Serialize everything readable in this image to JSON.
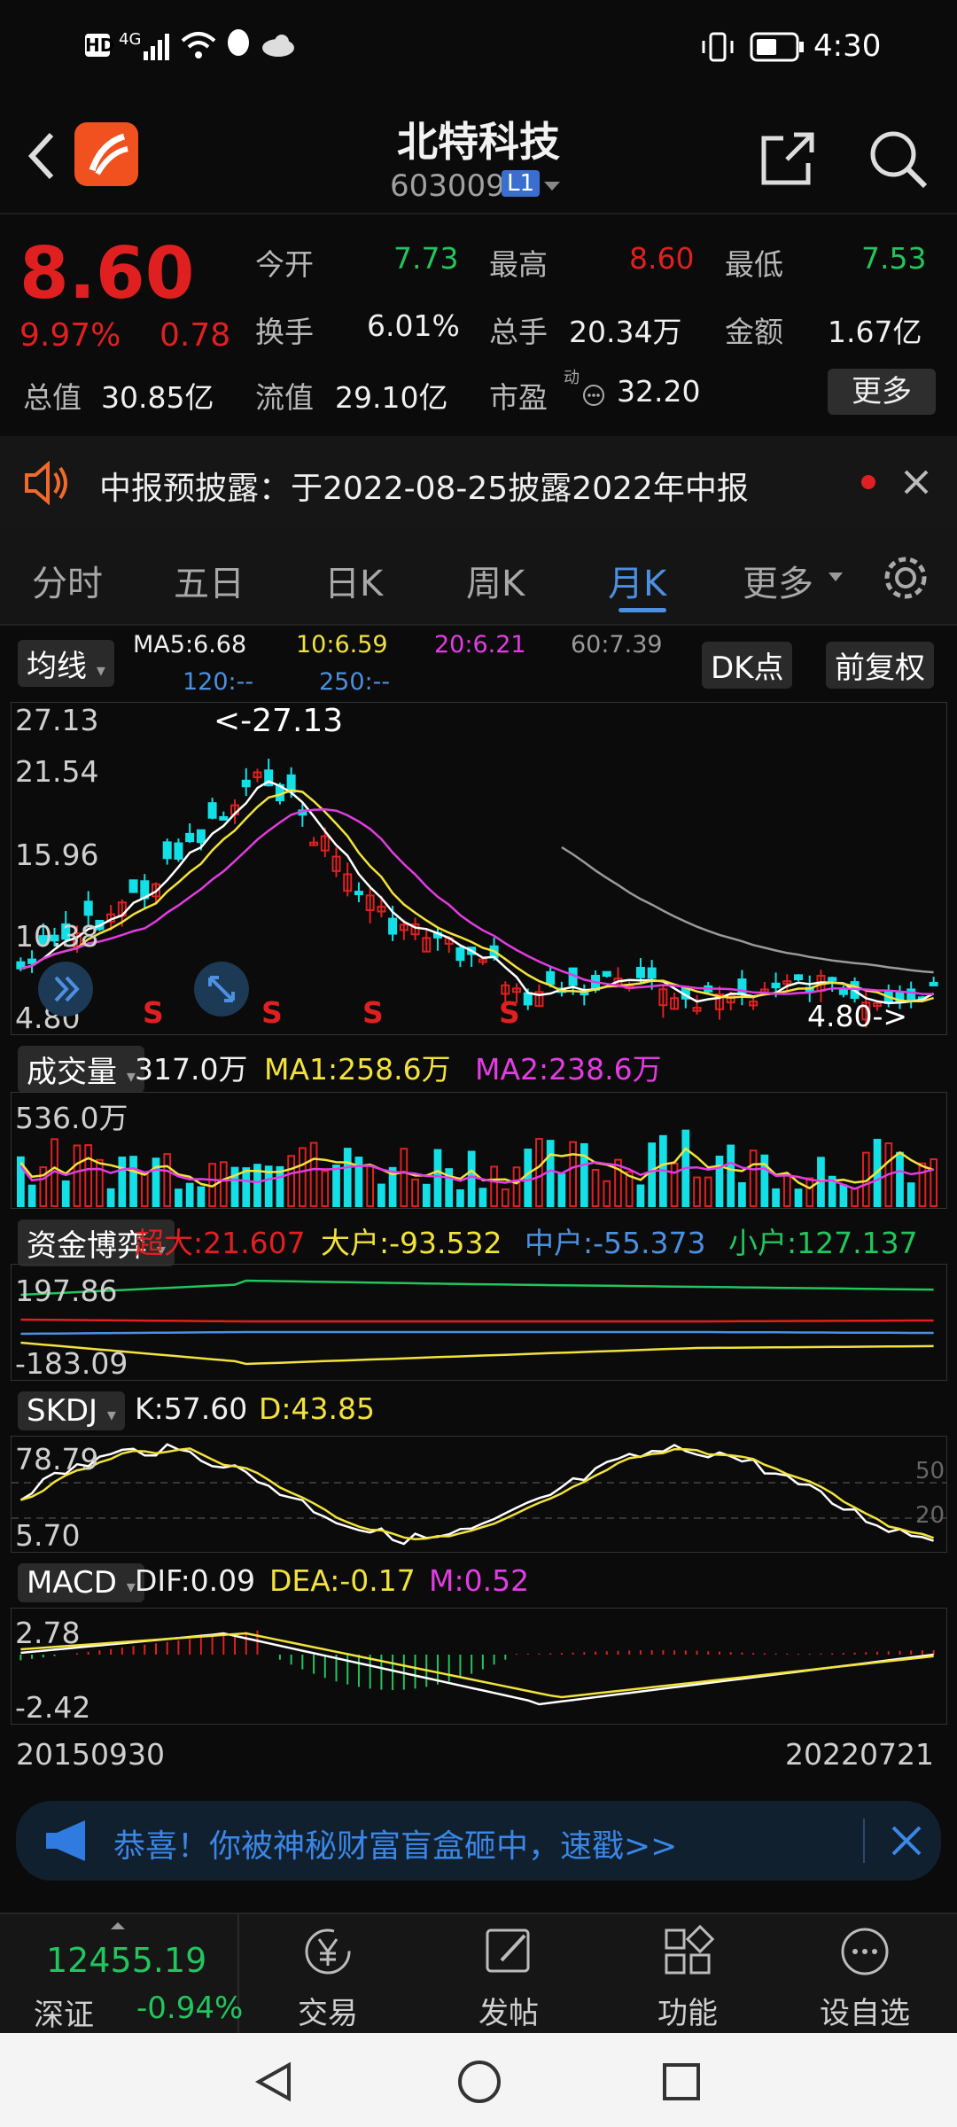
{
  "status_bar": {
    "left_icons": [
      "HD",
      "4G"
    ],
    "time": "4:30"
  },
  "header": {
    "title": "北特科技",
    "code": "603009",
    "level_badge": "L1"
  },
  "quote": {
    "price": "8.60",
    "change_pct": "9.97%",
    "change": "0.78",
    "open_label": "今开",
    "open": "7.73",
    "high_label": "最高",
    "high": "8.60",
    "low_label": "最低",
    "low": "7.53",
    "turnover_label": "换手",
    "turnover": "6.01%",
    "volume_label": "总手",
    "volume": "20.34万",
    "amount_label": "金额",
    "amount": "1.67亿",
    "mktcap_label": "总值",
    "mktcap": "30.85亿",
    "float_label": "流值",
    "float_cap": "29.10亿",
    "pe_label": "市盈",
    "pe_sup": "动",
    "pe": "32.20",
    "more_label": "更多"
  },
  "notice": {
    "text": "中报预披露：于2022-08-25披露2022年中报"
  },
  "tabs": {
    "items": [
      "分时",
      "五日",
      "日K",
      "周K",
      "月K",
      "更多"
    ],
    "active_index": 4
  },
  "main_chart": {
    "indicator_label": "均线",
    "ma5": "MA5:6.68",
    "ma10": "10:6.59",
    "ma20": "20:6.21",
    "ma60": "60:7.39",
    "ma120": "120:--",
    "ma250": "250:--",
    "dk_label": "DK点",
    "adjust_label": "前复权",
    "y_labels": [
      "27.13",
      "21.54",
      "15.96",
      "10.38",
      "4.80"
    ],
    "max_marker": "<-27.13",
    "min_marker": "4.80->",
    "signal": "S"
  },
  "volume_panel": {
    "label": "成交量",
    "value": "317.0万",
    "ma1": "MA1:258.6万",
    "ma2": "MA2:238.6万",
    "y_label": "536.0万"
  },
  "fund_panel": {
    "label": "资金博弈",
    "super": "超大:21.607",
    "big": "大户:-93.532",
    "mid": "中户:-55.373",
    "small": "小户:127.137",
    "y_top": "197.86",
    "y_bottom": "-183.09"
  },
  "skdj_panel": {
    "label": "SKDJ",
    "k": "K:57.60",
    "d": "D:43.85",
    "y_top": "78.79",
    "y_bottom": "5.70",
    "ref_high": "50",
    "ref_low": "20"
  },
  "macd_panel": {
    "label": "MACD",
    "dif": "DIF:0.09",
    "dea": "DEA:-0.17",
    "m": "M:0.52",
    "y_top": "2.78",
    "y_bottom": "-2.42"
  },
  "date_range": {
    "start": "20150930",
    "end": "20220721"
  },
  "ad_banner": {
    "text": "恭喜！你被神秘财富盲盒砸中，速戳>>"
  },
  "bottom_nav": {
    "index_value": "12455.19",
    "index_name": "深证",
    "index_change": "-0.94%",
    "items": [
      "交易",
      "发帖",
      "功能",
      "设自选"
    ]
  },
  "colors": {
    "up": "#e02020",
    "down": "#22c55e",
    "accent": "#4d8fe0",
    "cyan": "#13e0e6",
    "yellow": "#f2e23c",
    "magenta": "#e23ce2"
  }
}
